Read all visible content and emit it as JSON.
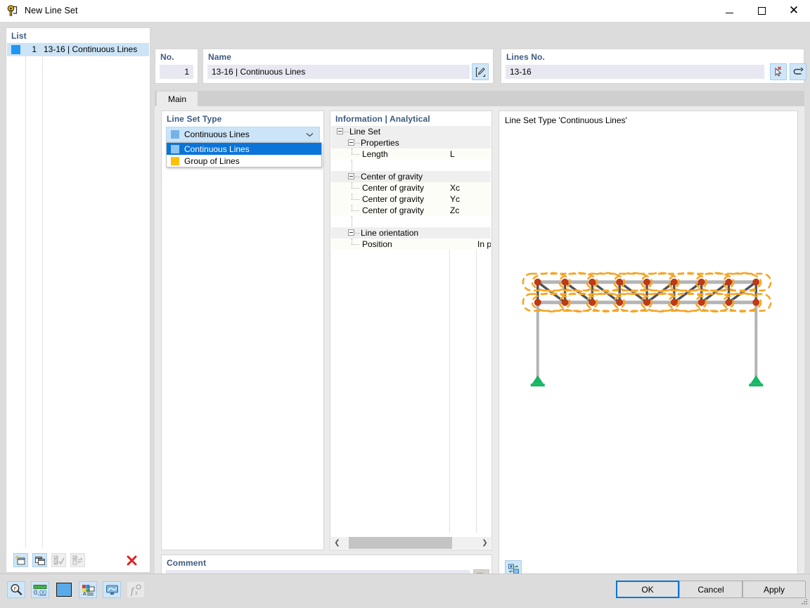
{
  "window": {
    "title": "New Line Set",
    "icon": "line-set-icon",
    "controls": {
      "minimize": "minimize-icon",
      "maximize": "maximize-icon",
      "close": "close-icon"
    }
  },
  "list": {
    "title": "List",
    "rows": [
      {
        "index": "1",
        "label": "13-16 | Continuous Lines",
        "color": "#2196f3",
        "selected": true
      }
    ],
    "toolbar": [
      {
        "name": "new-line-set-button",
        "icon": "new-window-icon",
        "enabled": true
      },
      {
        "name": "copy-line-set-button",
        "icon": "copy-window-icon",
        "enabled": true
      },
      {
        "name": "select-all-button",
        "icon": "check-all-icon",
        "enabled": false
      },
      {
        "name": "invert-selection-button",
        "icon": "invert-check-icon",
        "enabled": false
      },
      {
        "name": "delete-button",
        "icon": "red-x-icon",
        "enabled": true
      }
    ]
  },
  "no_field": {
    "title": "No.",
    "value": "1"
  },
  "name_field": {
    "title": "Name",
    "value": "13-16 | Continuous Lines",
    "edit_button": "edit-pencil-icon"
  },
  "lines_no_field": {
    "title": "Lines No.",
    "value": "13-16",
    "pick_button": "pick-cursor-icon",
    "back_button": "undo-arrow-icon"
  },
  "tabs": [
    {
      "label": "Main",
      "active": true
    }
  ],
  "line_set_type": {
    "title": "Line Set Type",
    "selected": "Continuous Lines",
    "selected_color": "#74b3e8",
    "dropdown_open": true,
    "options": [
      {
        "label": "Continuous Lines",
        "color": "#74b3e8",
        "selected": true
      },
      {
        "label": "Group of Lines",
        "color": "#ffc107",
        "selected": false
      }
    ]
  },
  "information": {
    "title": "Information | Analytical",
    "rows": [
      {
        "type": "group",
        "depth": 0,
        "label": "Line Set",
        "symbol": "",
        "value": ""
      },
      {
        "type": "group",
        "depth": 1,
        "label": "Properties",
        "symbol": "",
        "value": ""
      },
      {
        "type": "item",
        "depth": 2,
        "label": "Length",
        "symbol": "L",
        "value": ""
      },
      {
        "type": "blank",
        "depth": 0,
        "label": "",
        "symbol": "",
        "value": ""
      },
      {
        "type": "group",
        "depth": 1,
        "label": "Center of gravity",
        "symbol": "",
        "value": ""
      },
      {
        "type": "item",
        "depth": 2,
        "label": "Center of gravity",
        "symbol": "Xc",
        "value": ""
      },
      {
        "type": "item",
        "depth": 2,
        "label": "Center of gravity",
        "symbol": "Yc",
        "value": ""
      },
      {
        "type": "item",
        "depth": 2,
        "label": "Center of gravity",
        "symbol": "Zc",
        "value": ""
      },
      {
        "type": "blank",
        "depth": 0,
        "label": "",
        "symbol": "",
        "value": ""
      },
      {
        "type": "group",
        "depth": 1,
        "label": "Line orientation",
        "symbol": "",
        "value": ""
      },
      {
        "type": "item",
        "depth": 2,
        "label": "Position",
        "symbol": "",
        "value": "In p"
      }
    ],
    "scrollbar": {
      "left_arrow": "chevron-left-icon",
      "right_arrow": "chevron-right-icon"
    }
  },
  "graphics": {
    "title": "Line Set Type 'Continuous Lines'",
    "view_button": "view-toggle-icon",
    "colors": {
      "member": "#b5b5b5",
      "diagonal": "#4e5159",
      "node": "#c03a12",
      "highlight": "#f5a524",
      "support": "#18b663",
      "column": "#b5b5b5"
    }
  },
  "comment": {
    "title": "Comment",
    "value": "",
    "placeholder": "",
    "chevron": "chevron-down-icon",
    "button": "copy-comment-icon"
  },
  "footer": {
    "tools": [
      {
        "name": "search-tool-button",
        "icon": "magnifier-icon",
        "enabled": true
      },
      {
        "name": "decimal-places-button",
        "icon": "number-format-icon",
        "enabled": true
      },
      {
        "name": "color-button",
        "icon": "color-swatch-icon",
        "enabled": true,
        "color": "#5aaae8"
      },
      {
        "name": "legend-button",
        "icon": "legend-icon",
        "enabled": true
      },
      {
        "name": "display-button",
        "icon": "monitor-icon",
        "enabled": true
      },
      {
        "name": "formula-button",
        "icon": "function-icon",
        "enabled": false
      }
    ],
    "buttons": [
      {
        "label": "OK",
        "primary": true
      },
      {
        "label": "Cancel",
        "primary": false
      },
      {
        "label": "Apply",
        "primary": false
      }
    ]
  }
}
